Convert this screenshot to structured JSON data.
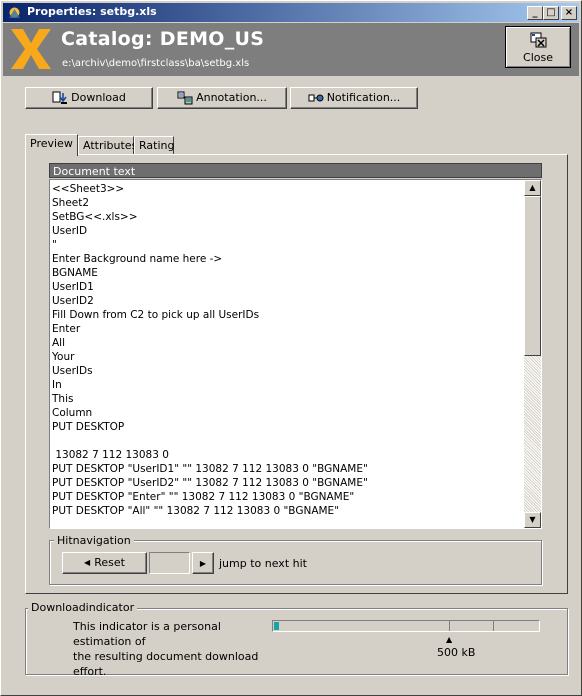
{
  "window": {
    "title": "Properties: setbg.xls",
    "controls": {
      "minimize": "_",
      "maximize": "□",
      "close": "×"
    }
  },
  "header": {
    "logo_letter": "X",
    "catalog_title": "Catalog: DEMO_US",
    "path": "e:\\archiv\\demo\\firstclass\\ba\\setbg.xls",
    "close_label": "Close"
  },
  "toolbar": {
    "download": "Download",
    "annotation": "Annotation...",
    "notification": "Notification..."
  },
  "tabs": [
    "Preview",
    "Attributes",
    "Rating"
  ],
  "document": {
    "header": "Document text",
    "lines": [
      "<<Sheet3>>",
      "Sheet2",
      "SetBG<<.xls>>",
      "UserID",
      "\"",
      "Enter Background name here ->",
      "BGNAME",
      "UserID1",
      "UserID2",
      "Fill Down from C2 to pick up all UserIDs",
      "Enter",
      "All",
      "Your",
      "UserIDs",
      "In",
      "This",
      "Column",
      "PUT DESKTOP",
      "",
      " 13082 7 112 13083 0",
      "PUT DESKTOP \"UserID1\" \"\" 13082 7 112 13083 0 \"BGNAME\"",
      "PUT DESKTOP \"UserID2\" \"\" 13082 7 112 13083 0 \"BGNAME\"",
      "PUT DESKTOP \"Enter\" \"\" 13082 7 112 13083 0 \"BGNAME\"",
      "PUT DESKTOP \"All\" \"\" 13082 7 112 13083 0 \"BGNAME\""
    ]
  },
  "hitnavigation": {
    "title": "Hitnavigation",
    "reset": "Reset",
    "next_hint": "jump to next hit",
    "hit_value": ""
  },
  "downloadindicator": {
    "title": "Downloadindicator",
    "line1": "This indicator is a personal estimation of",
    "line2": "the resulting document download effort.",
    "marker_label": "500 kB",
    "level_fraction": 0.02
  },
  "colors": {
    "titlebar_start": "#0a246a",
    "titlebar_end": "#a6caf0",
    "logo_orange": "#f7a81b",
    "header_gray": "#7e7e7e",
    "meter_fill": "#1aa5a5"
  }
}
